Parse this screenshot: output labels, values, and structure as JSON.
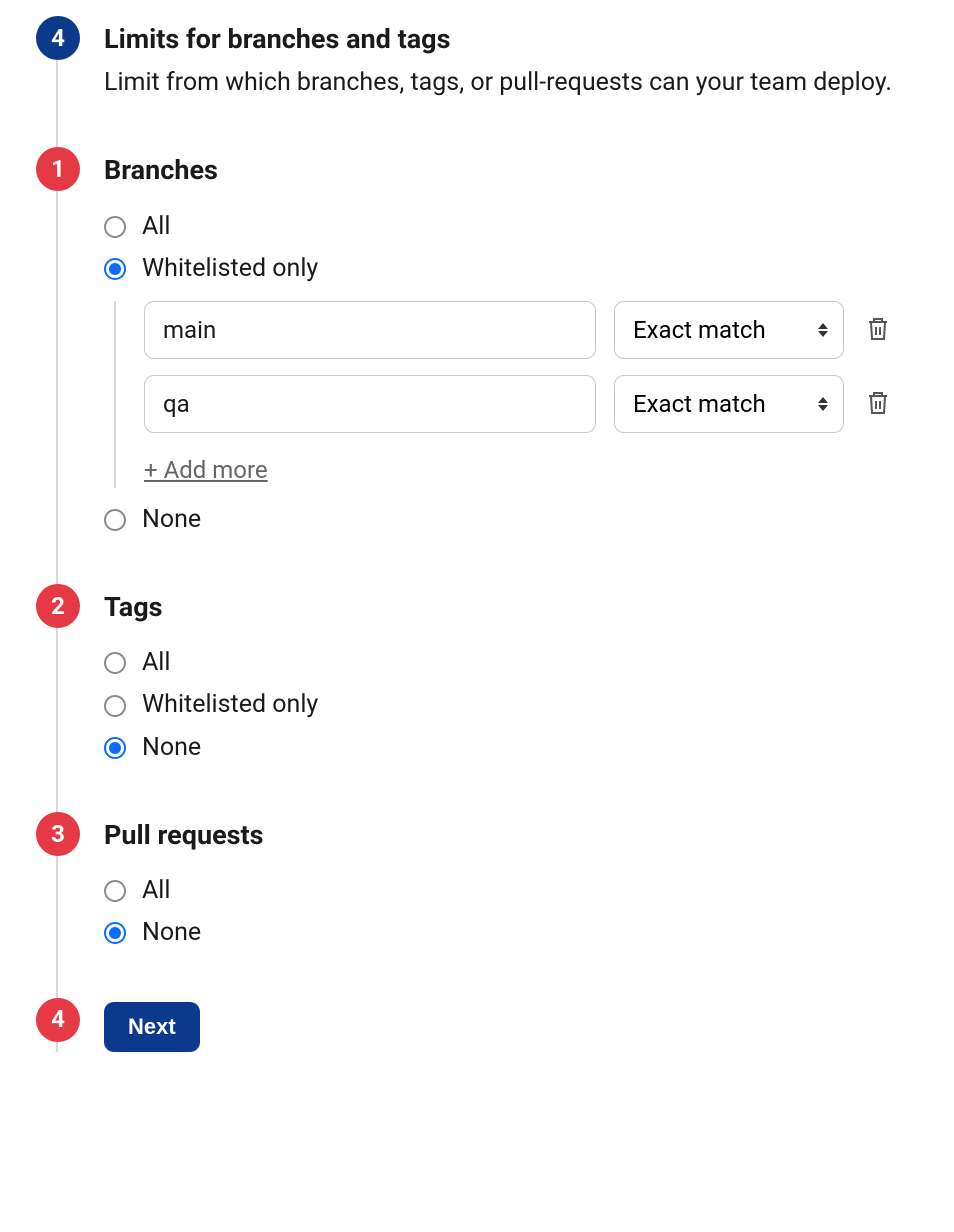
{
  "header": {
    "badge": "4",
    "title": "Limits for branches and tags",
    "description": "Limit from which branches, tags, or pull-requests can your team deploy."
  },
  "branches": {
    "badge": "1",
    "title": "Branches",
    "options": {
      "all": "All",
      "whitelisted": "Whitelisted only",
      "none": "None"
    },
    "selected": "whitelisted",
    "whitelist": [
      {
        "value": "main",
        "match": "Exact match"
      },
      {
        "value": "qa",
        "match": "Exact match"
      }
    ],
    "add_more": "+ Add more"
  },
  "tags": {
    "badge": "2",
    "title": "Tags",
    "options": {
      "all": "All",
      "whitelisted": "Whitelisted only",
      "none": "None"
    },
    "selected": "none"
  },
  "pull_requests": {
    "badge": "3",
    "title": "Pull requests",
    "options": {
      "all": "All",
      "none": "None"
    },
    "selected": "none"
  },
  "footer": {
    "badge": "4",
    "next_label": "Next"
  }
}
